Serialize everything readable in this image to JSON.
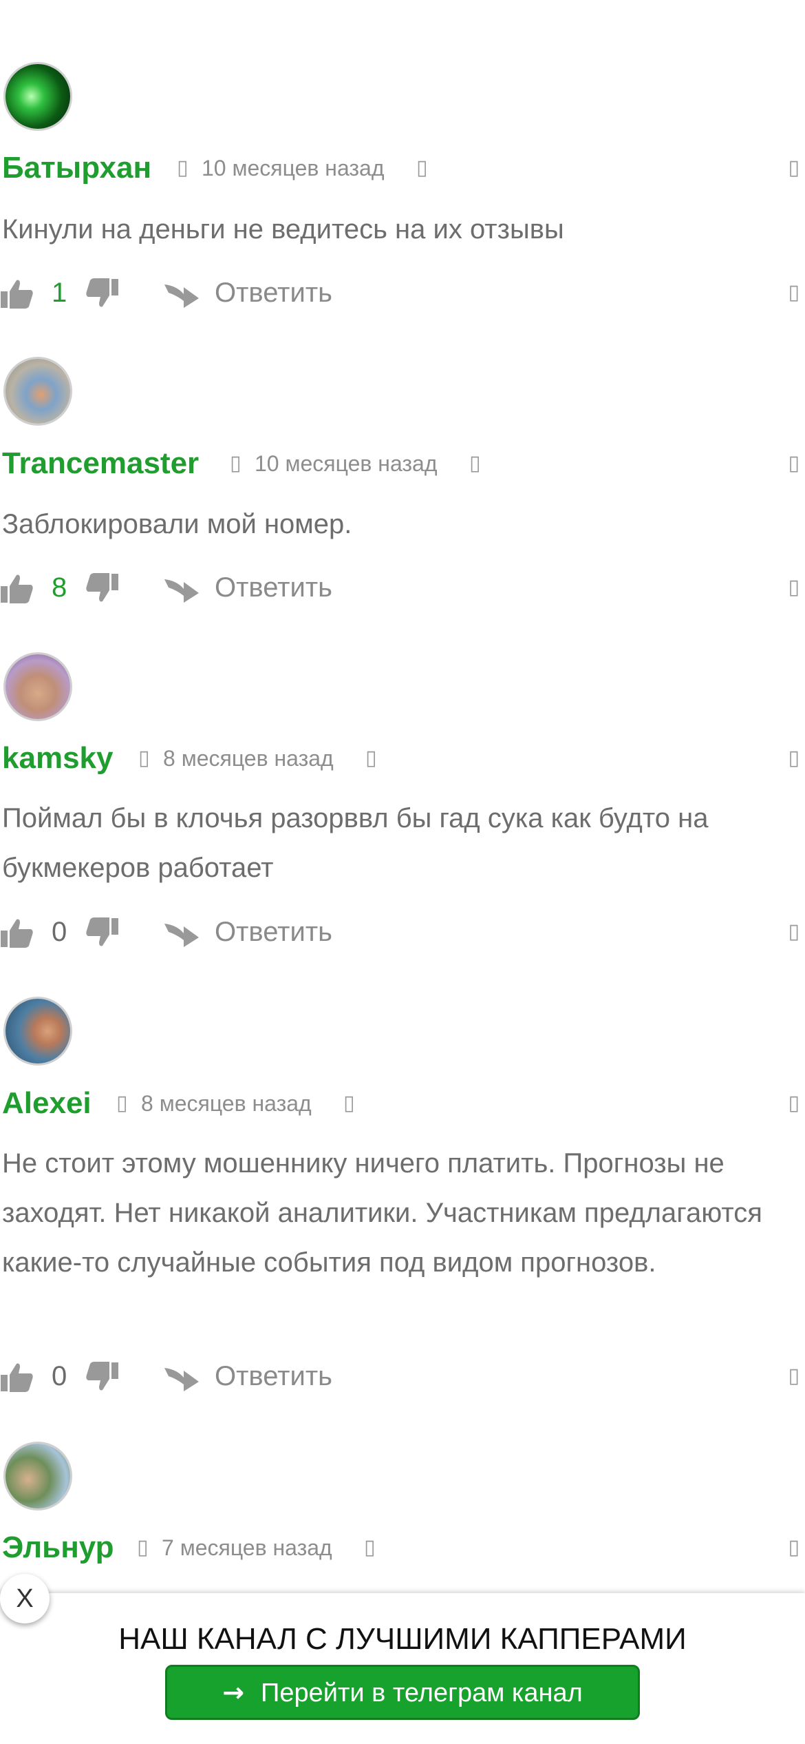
{
  "comments": [
    {
      "author": "Батырхан",
      "time": "10 месяцев назад",
      "text": "Кинули на деньги не ведитесь на их отзывы",
      "likes": "1",
      "reply_label": "Ответить"
    },
    {
      "author": "Trancemaster",
      "time": "10 месяцев назад",
      "text": "Заблокировали мой номер.",
      "likes": "8",
      "reply_label": "Ответить"
    },
    {
      "author": "kamsky",
      "time": "8 месяцев назад",
      "text": "Поймал бы в клочья разорввл бы гад сука как будто на букмекеров работает",
      "likes": "0",
      "reply_label": "Ответить"
    },
    {
      "author": "Alexei",
      "time": "8 месяцев назад",
      "text": "Не стоит этому мошеннику ничего платить. Прогнозы не заходят. Нет никакой аналитики. Участникам предлагаются какие-то случайные события под видом прогнозов.",
      "likes": "0",
      "reply_label": "Ответить"
    },
    {
      "author": "Эльнур",
      "time": "7 месяцев назад"
    }
  ],
  "icons": {
    "like": "thumbs-up-icon",
    "dislike": "thumbs-down-icon",
    "reply": "reply-arrow-icon",
    "placeholder_glyph": "▯"
  },
  "banner": {
    "close_label": "X",
    "title": "НАШ КАНАЛ С ЛУЧШИМИ КАППЕРАМИ",
    "button_label": "Перейти в телеграм канал",
    "button_arrow": "→"
  },
  "colors": {
    "accent": "#1f9d2e",
    "button": "#16a22c",
    "text": "#6d6d6d"
  }
}
